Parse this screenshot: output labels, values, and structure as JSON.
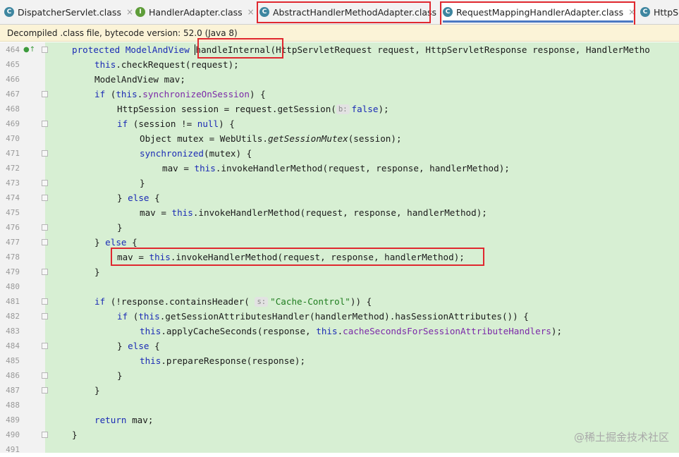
{
  "tabs": [
    {
      "label": "DispatcherServlet.class",
      "icon": "class-icon",
      "icon_glyph": "C",
      "close": "×"
    },
    {
      "label": "HandlerAdapter.class",
      "icon": "interface-icon",
      "icon_glyph": "I",
      "close": "×"
    },
    {
      "label": "AbstractHandlerMethodAdapter.class",
      "icon": "class-icon",
      "icon_glyph": "C",
      "close": "×"
    },
    {
      "label": "RequestMappingHandlerAdapter.class",
      "icon": "class-icon",
      "icon_glyph": "C",
      "close": "×",
      "active": true
    },
    {
      "label": "HttpSe",
      "icon": "class-icon",
      "icon_glyph": "C"
    }
  ],
  "infobar": {
    "text": "Decompiled .class file, bytecode version: 52.0 (Java 8)"
  },
  "hints": {
    "b": "b:",
    "s": "s:"
  },
  "code": {
    "l464_a": "protected ModelAndView ",
    "l464_b": "handleInternal",
    "l464_c": "(HttpServletRequest request, HttpServletResponse response, HandlerMetho",
    "this": "this",
    "checkRequest": ".checkRequest(request);",
    "mav_decl": "ModelAndView mav;",
    "if": "if",
    "else": "else",
    "sync_on_session": "synchronizeOnSession",
    "brace_open": ") {",
    "open_paren": " (",
    "session_decl": "HttpSession session = request.getSession(",
    "false": "false",
    "close_paren_semicolon": ");",
    "session_null": " (session != ",
    "null": "null",
    "mutex_decl": "Object mutex = WebUtils.",
    "getSessionMutex": "getSessionMutex",
    "mutex_end": "(session);",
    "synchronized": "synchronized",
    "mutex_arg": "(mutex) {",
    "mav_assign": "mav = ",
    "invoke": ".invokeHandlerMethod(request, response, handlerMethod);",
    "close_brace": "}",
    "close_else": "} ",
    "brace": " {",
    "contains_header": " (!response.containsHeader(",
    "cache_control": "\"Cache-Control\"",
    "paren_brace": ")) {",
    "get_sah": ".getSessionAttributesHandler(handlerMethod).hasSessionAttributes()) {",
    "apply_cache": ".applyCacheSeconds(response, ",
    "cache_field": "cacheSecondsForSessionAttributeHandlers",
    "prepare": ".prepareResponse(response);",
    "return": "return",
    "return_tail": " mav;"
  },
  "line_numbers": [
    "464",
    "465",
    "466",
    "467",
    "468",
    "469",
    "470",
    "471",
    "472",
    "473",
    "474",
    "475",
    "476",
    "477",
    "478",
    "479",
    "480",
    "481",
    "482",
    "483",
    "484",
    "485",
    "486",
    "487",
    "488",
    "489",
    "490",
    "491"
  ],
  "watermark": "@稀土掘金技术社区",
  "colors": {
    "keyword": "#1b2bb5",
    "field": "#7b28a8",
    "string": "#1f7d1f",
    "highlight": "#d7efd3",
    "annotation": "#e0282f",
    "active_tab": "#4a78c2"
  }
}
